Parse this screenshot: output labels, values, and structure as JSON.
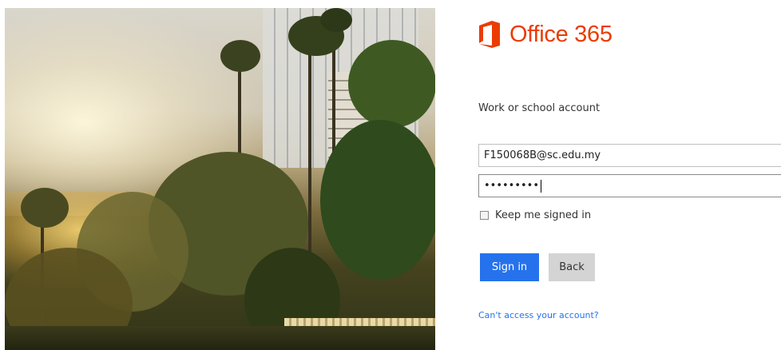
{
  "brand": {
    "name": "Office 365",
    "accent_color": "#eb3c00",
    "icon": "office-logo-icon"
  },
  "signin": {
    "account_label": "Work or school account",
    "email_value": "F150068B@sc.edu.my",
    "password_value": "•••••••••",
    "keep_signed_in_label": "Keep me signed in",
    "keep_signed_in_checked": false,
    "sign_in_label": "Sign in",
    "back_label": "Back",
    "help_link": "Can't access your account?",
    "primary_color": "#2672ec"
  }
}
